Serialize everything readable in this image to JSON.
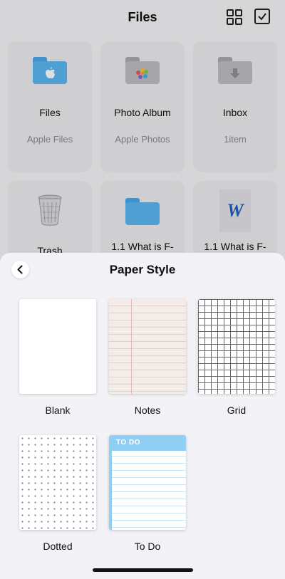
{
  "header": {
    "title": "Files",
    "grid_icon": "grid-view-icon",
    "select_icon": "checkbox-select-icon"
  },
  "tiles": [
    {
      "name": "Files",
      "subtitle": "Apple Files",
      "icon": "blue-folder-apple-icon"
    },
    {
      "name": "Photo Album",
      "subtitle": "Apple Photos",
      "icon": "gray-folder-photos-icon"
    },
    {
      "name": "Inbox",
      "subtitle": "1item",
      "icon": "gray-folder-download-icon"
    },
    {
      "name": "Trash",
      "subtitle": "",
      "icon": "trash-can-icon"
    },
    {
      "name": "1.1 What is F-",
      "subtitle": "",
      "icon": "blue-folder-icon"
    },
    {
      "name": "1.1 What is F-",
      "subtitle": "",
      "icon": "word-document-icon"
    }
  ],
  "sheet": {
    "title": "Paper Style",
    "back_icon": "chevron-left-icon",
    "styles": [
      {
        "label": "Blank"
      },
      {
        "label": "Notes"
      },
      {
        "label": "Grid"
      },
      {
        "label": "Dotted"
      },
      {
        "label": "To Do",
        "header_text": "TO DO"
      }
    ]
  },
  "colors": {
    "sheet_bg": "#f2f2f7",
    "folder_blue": "#5bb6ef",
    "todo_blue": "#8fcff3",
    "notes_margin": "#e9b8b8"
  }
}
